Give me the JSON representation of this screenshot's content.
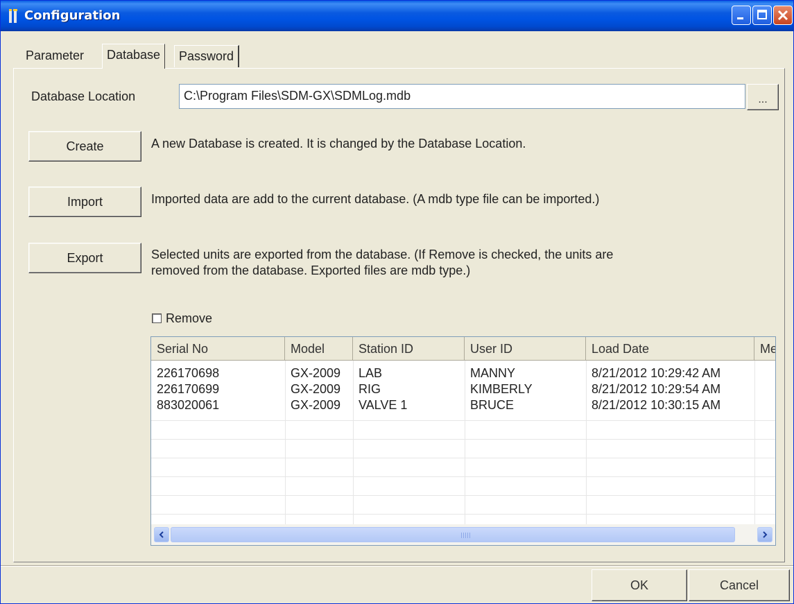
{
  "window": {
    "title": "Configuration",
    "icon": "app-icon",
    "controls": [
      "minimize-icon",
      "maximize-icon",
      "close-icon"
    ]
  },
  "tabs": [
    {
      "label": "Parameter",
      "active": false
    },
    {
      "label": "Database",
      "active": true
    },
    {
      "label": "Password",
      "active": false
    }
  ],
  "database": {
    "location_label": "Database Location",
    "location_value": "C:\\Program Files\\SDM-GX\\SDMLog.mdb",
    "browse_label": "...",
    "create": {
      "button_label": "Create",
      "description": "A new Database is created. It is changed by the Database Location."
    },
    "import": {
      "button_label": "Import",
      "description": "Imported data are add to the current database. (A mdb type file can be imported.)"
    },
    "export": {
      "button_label": "Export",
      "description_line1": "Selected units are exported from the database. (If Remove is checked, the units are",
      "description_line2": "removed from the database. Exported files are mdb type.)"
    },
    "remove_label": "Remove",
    "remove_checked": false
  },
  "table": {
    "columns": [
      "Serial No",
      "Model",
      "Station ID",
      "User ID",
      "Load Date",
      "Me"
    ],
    "rows": [
      [
        "226170698",
        "GX-2009",
        "LAB",
        "MANNY",
        "8/21/2012 10:29:42 AM",
        ""
      ],
      [
        "226170699",
        "GX-2009",
        "RIG",
        "KIMBERLY",
        "8/21/2012 10:29:54 AM",
        ""
      ],
      [
        "883020061",
        "GX-2009",
        "VALVE 1",
        "BRUCE",
        "8/21/2012 10:30:15 AM",
        ""
      ]
    ]
  },
  "footer": {
    "ok_label": "OK",
    "cancel_label": "Cancel"
  },
  "colors": {
    "titlebar": "#0054e3",
    "face": "#ece9d8",
    "close_button": "#c8441f"
  }
}
